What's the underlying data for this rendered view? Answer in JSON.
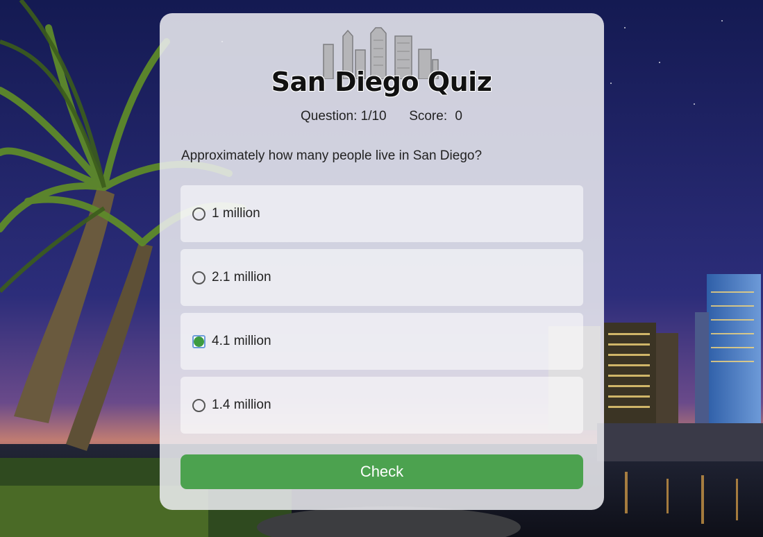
{
  "quiz": {
    "title": "San Diego Quiz",
    "question_label": "Question:",
    "question_progress": "1/10",
    "score_label": "Score:",
    "score_value": "0",
    "question_text": "Approximately how many people live in San Diego?",
    "options": [
      {
        "label": "1 million",
        "selected": false
      },
      {
        "label": "2.1 million",
        "selected": false
      },
      {
        "label": "4.1 million",
        "selected": true
      },
      {
        "label": "1.4 million",
        "selected": false
      }
    ],
    "check_label": "Check"
  },
  "colors": {
    "accent": "#4ca24f",
    "selected_radio": "#3d9b40"
  },
  "icons": {
    "logo": "skyline-icon"
  }
}
